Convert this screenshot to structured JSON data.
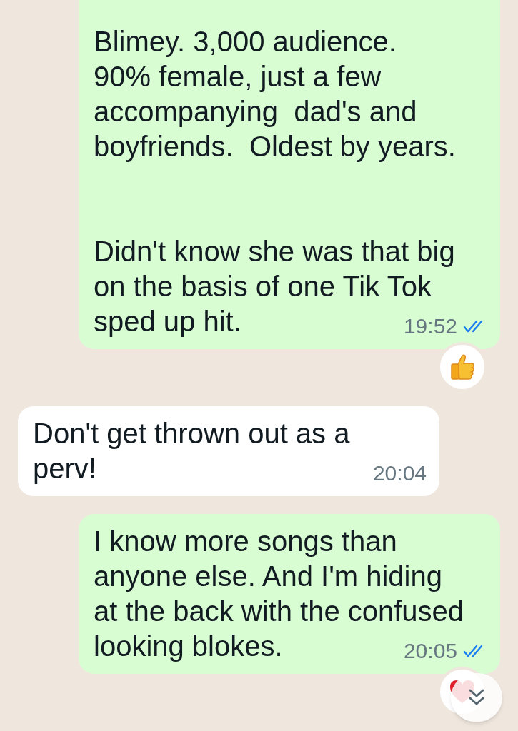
{
  "messages": [
    {
      "kind": "outgoing",
      "paragraphs": [
        [
          "Blimey. 3,000 audience.",
          "90% female, just a few",
          "accompanying  dad's and",
          "boyfriends.  Oldest by years."
        ],
        [
          "Didn't know she was that big",
          "on the basis of one Tik Tok",
          "sped up hit."
        ]
      ],
      "time": "19:52",
      "read": true,
      "reaction": {
        "kind": "thumbs_up"
      }
    },
    {
      "kind": "incoming",
      "paragraphs": [
        [
          "Don't get thrown out as a",
          "perv!"
        ]
      ],
      "time": "20:04"
    },
    {
      "kind": "outgoing",
      "paragraphs": [
        [
          "I know more songs than",
          "anyone else. And I'm hiding",
          "at the back with the confused",
          "looking blokes."
        ]
      ],
      "time": "20:05",
      "read": true,
      "reaction": {
        "kind": "heart"
      }
    }
  ],
  "scroll_down_button": true
}
